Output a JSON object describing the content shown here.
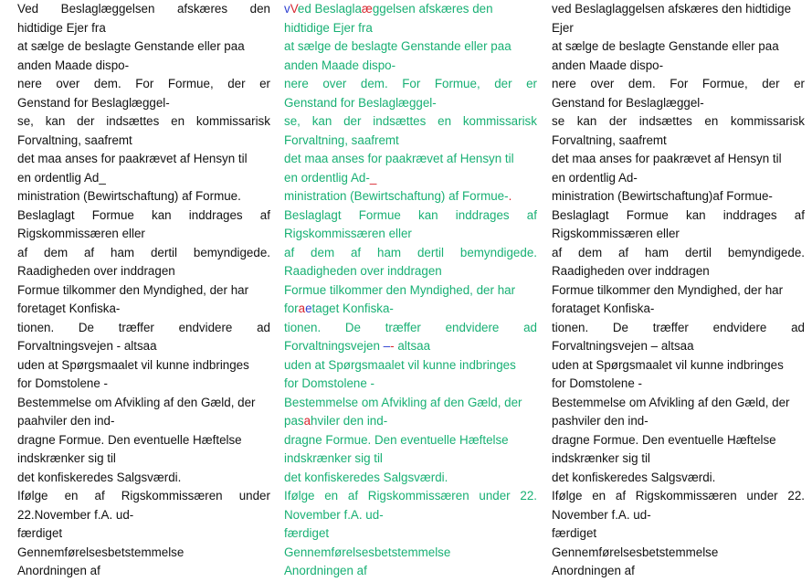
{
  "columns": {
    "original": [
      "Ved Beslaglæggelsen afskæres den",
      "hidtidige Ejer fra",
      "at sælge de beslagte Genstande eller paa",
      "anden Maade dispo-",
      "nere over dem. For Formue, der er",
      "Genstand for Beslaglæggel-",
      "se, kan der indsættes en kommissarisk",
      "Forvaltning, saafremt",
      "det maa anses for paakrævet af Hensyn til",
      "en ordentlig Ad_",
      "ministration (Bewirtschaftung) af Formue.",
      "Beslaglagt Formue kan inddrages af",
      "Rigskommissæren eller",
      "af dem af ham dertil bemyndigede.",
      "Raadigheden over inddragen",
      "Formue tilkommer den Myndighed, der har",
      "foretaget Konfiska-",
      "tionen. De træffer endvidere ad",
      "Forvaltningsvejen - altsaa",
      "uden at Spørgsmaalet vil kunne indbringes",
      "for Domstolene -",
      "Bestemmelse om Afvikling af den Gæld, der",
      "paahviler den ind-",
      "dragne Formue. Den eventuelle Hæftelse",
      "indskrænker sig til",
      "det konfiskeredes Salgsværdi.",
      "Ifølge en af Rigskommissæren under",
      "22.November f.A. ud-",
      "færdiget",
      "Gennemførelsesbetstemmelse",
      "Anordningen af"
    ],
    "diff": [
      "vVed Beslaglaæggelsen afskæres den",
      "hidtidige Ejer fra",
      "at sælge de beslagte Genstande eller paa",
      "anden Maade dispo-",
      "nere over dem. For Formue, der er",
      "Genstand for Beslaglæggel-",
      "se, kan der indsættes en kommissarisk",
      "Forvaltning, saafremt",
      "det maa anses for paakrævet af Hensyn til",
      "en ordentlig Ad-_",
      "ministration (Bewirtschaftung) af Formue-.",
      "Beslaglagt Formue kan inddrages af",
      "Rigskommissæren eller",
      "af dem af ham dertil bemyndigede.",
      "Raadigheden over inddragen",
      "Formue tilkommer den Myndighed, der har",
      "foraetaget Konfiska-",
      "tionen. De træffer endvidere ad",
      "Forvaltningsvejen –- altsaa",
      "uden at Spørgsmaalet vil kunne indbringes",
      "for Domstolene -",
      "Bestemmelse om Afvikling af den Gæld, der",
      "pasahviler den ind-",
      "dragne Formue. Den eventuelle Hæftelse",
      "indskrænker sig til",
      "det konfiskeredes Salgsværdi.",
      "Ifølge en af Rigskommissæren under 22.",
      "November f.A. ud-",
      "færdiget",
      "Gennemførelsesbetstemmelse",
      "Anordningen af"
    ],
    "corrected": [
      "ved Beslaglaggelsen afskæres den hidtidige",
      "Ejer",
      "at sælge de beslagte Genstande eller paa",
      "anden Maade dispo-",
      "nere over dem. For Formue, der er",
      "Genstand for Beslaglæggel-",
      "se kan der indsættes en kommissarisk",
      "Forvaltning, saafremt",
      "det maa anses for paakrævet af Hensyn til",
      "en ordentlig Ad-",
      "ministration (Bewirtschaftung)af Formue-",
      "Beslaglagt Formue kan inddrages af",
      "Rigskommissæren eller",
      "af dem af ham dertil bemyndigede.",
      "Raadigheden over inddragen",
      "Formue tilkommer den Myndighed, der har",
      "forataget Konfiska-",
      "tionen. De træffer endvidere ad",
      "Forvaltningsvejen – altsaa",
      "uden at Spørgsmaalet vil kunne indbringes",
      "for Domstolene -",
      "Bestemmelse om Afvikling af den Gæld, der",
      "pashviler den ind-",
      "dragne Formue. Den eventuelle Hæftelse",
      "indskrænker sig til",
      "det konfiskeredes Salgsværdi.",
      "Ifølge en af Rigskommissæren under 22.",
      "November f.A. ud-",
      "færdiget",
      "Gennemførelsesbetstemmelse",
      "Anordningen af"
    ]
  },
  "justified_lines": {
    "original": [
      0,
      4,
      6,
      11,
      13,
      17,
      26
    ],
    "diff": [
      0,
      4,
      6,
      11,
      13,
      17,
      26
    ],
    "corrected": [
      4,
      6,
      11,
      13,
      17,
      26
    ]
  },
  "diff_markup": {
    "0": [
      [
        "ins",
        "v"
      ],
      [
        "del",
        "V"
      ],
      [
        "",
        "ed Beslagla"
      ],
      [
        "del",
        "æ"
      ],
      [
        "",
        "ggelsen afskæres den"
      ]
    ],
    "9": [
      [
        "",
        "en ordentlig Ad-"
      ],
      [
        "del",
        "_"
      ]
    ],
    "10": [
      [
        "",
        "ministration (Bewirtschaftung) af Formue-"
      ],
      [
        "del",
        "."
      ]
    ],
    "16": [
      [
        "",
        "for"
      ],
      [
        "del",
        "a"
      ],
      [
        "ins",
        "e"
      ],
      [
        "",
        "taget Konfiska-"
      ]
    ],
    "18": [
      [
        "",
        "Forvaltningsvejen "
      ],
      [
        "ins",
        "–"
      ],
      [
        "del",
        "-"
      ],
      [
        "",
        " altsaa"
      ]
    ],
    "22": [
      [
        "",
        "pas"
      ],
      [
        "del",
        "a"
      ],
      [
        "",
        "hviler den ind-"
      ]
    ]
  },
  "colors": {
    "text": "#111111",
    "diff_text": "#18b074",
    "deleted": "#d8262f",
    "inserted": "#2d3fd1"
  }
}
